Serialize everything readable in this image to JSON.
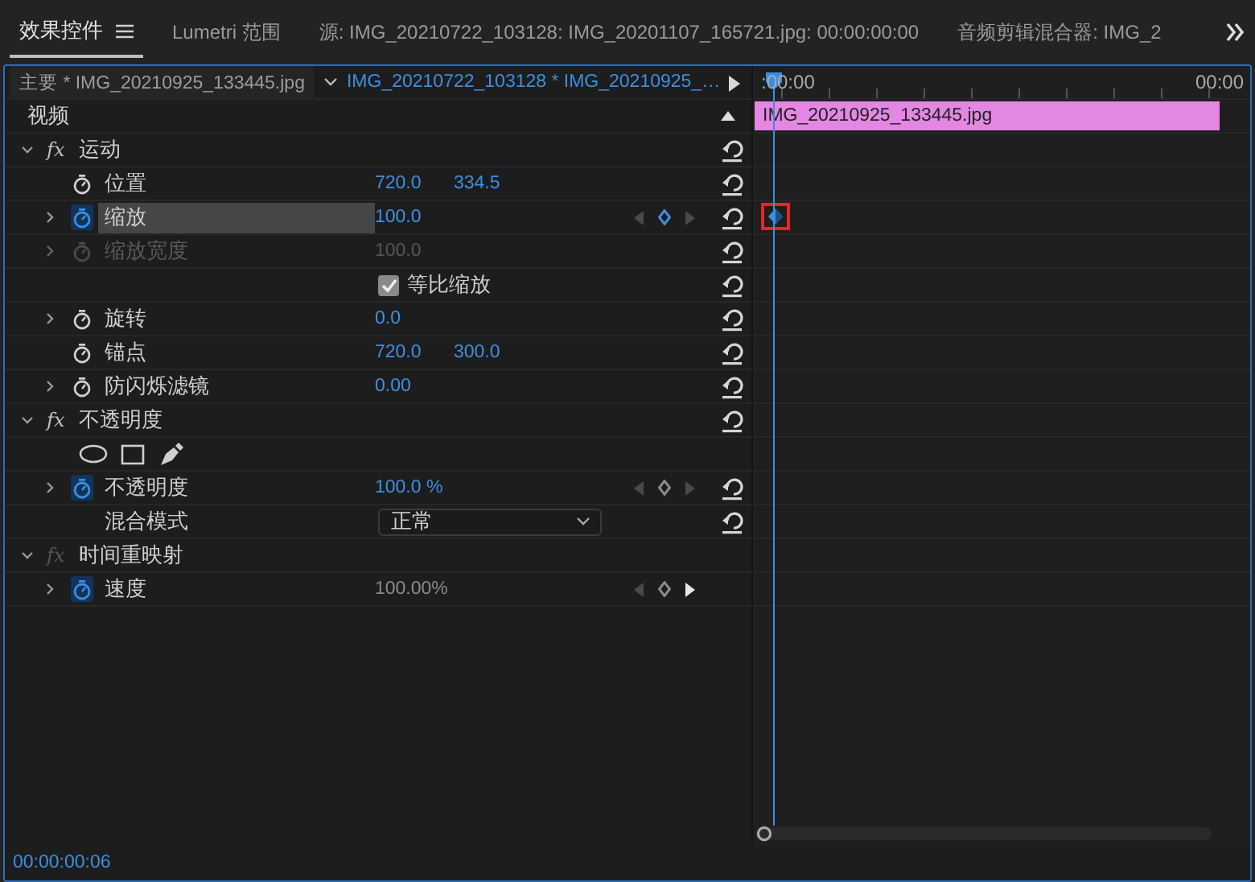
{
  "tabs": [
    {
      "label": "效果控件",
      "selected": true,
      "menu": true
    },
    {
      "label": "Lumetri 范围",
      "selected": false
    },
    {
      "label": "源: IMG_20210722_103128: IMG_20201107_165721.jpg: 00:00:00:00",
      "selected": false
    },
    {
      "label": "音频剪辑混合器: IMG_2",
      "selected": false
    }
  ],
  "clip_header": {
    "master": "主要 * IMG_20210925_133445.jpg",
    "sequence": "IMG_20210722_103128 * IMG_20210925_…"
  },
  "timeline": {
    "start": ":00:00",
    "end": "00:00",
    "clip": "IMG_20210925_133445.jpg"
  },
  "section": {
    "label": "视频",
    "expanded": true
  },
  "rows": [
    {
      "kind": "group",
      "fx": "fx",
      "label": "运动",
      "expanded": true,
      "fx_on": true,
      "reset": true
    },
    {
      "kind": "param",
      "label": "位置",
      "animated": false,
      "selected": false,
      "editable": true,
      "values": [
        "720.0",
        "334.5"
      ],
      "reset": true
    },
    {
      "kind": "param",
      "label": "缩放",
      "expandable": true,
      "animated": true,
      "selected": true,
      "editable": true,
      "values": [
        "100.0"
      ],
      "keyframes": {
        "at_keyframe": true,
        "next_active": false
      },
      "timeline_keyframe": {
        "highlighted": true
      },
      "reset": true
    },
    {
      "kind": "param",
      "label": "缩放宽度",
      "expandable": true,
      "animated": false,
      "selected": false,
      "disabled": true,
      "values": [
        "100.0"
      ],
      "reset": true
    },
    {
      "kind": "checkbox",
      "label": "等比缩放",
      "checked": true,
      "reset": true
    },
    {
      "kind": "param",
      "label": "旋转",
      "expandable": true,
      "animated": false,
      "selected": false,
      "editable": true,
      "values": [
        "0.0"
      ],
      "reset": true
    },
    {
      "kind": "param",
      "label": "锚点",
      "animated": false,
      "selected": false,
      "editable": true,
      "values": [
        "720.0",
        "300.0"
      ],
      "reset": true
    },
    {
      "kind": "param",
      "label": "防闪烁滤镜",
      "expandable": true,
      "animated": false,
      "selected": false,
      "editable": true,
      "values": [
        "0.00"
      ],
      "reset": true
    },
    {
      "kind": "group",
      "fx": "fx",
      "label": "不透明度",
      "expanded": true,
      "fx_on": true,
      "reset": true
    },
    {
      "kind": "masks"
    },
    {
      "kind": "param",
      "label": "不透明度",
      "expandable": true,
      "animated": true,
      "selected": false,
      "editable": true,
      "values": [
        "100.0 %"
      ],
      "keyframes": {
        "at_keyframe": false,
        "next_active": false
      },
      "reset": true
    },
    {
      "kind": "dropdown",
      "label": "混合模式",
      "value": "正常",
      "reset": true
    },
    {
      "kind": "group",
      "fx": "fx",
      "label": "时间重映射",
      "expanded": true,
      "fx_on": false
    },
    {
      "kind": "param",
      "label": "速度",
      "expandable": true,
      "animated": true,
      "selected": false,
      "editable": false,
      "values": [
        "100.00%"
      ],
      "keyframes": {
        "at_keyframe": false,
        "next_active": true
      }
    }
  ],
  "timecode": "00:00:00:06"
}
